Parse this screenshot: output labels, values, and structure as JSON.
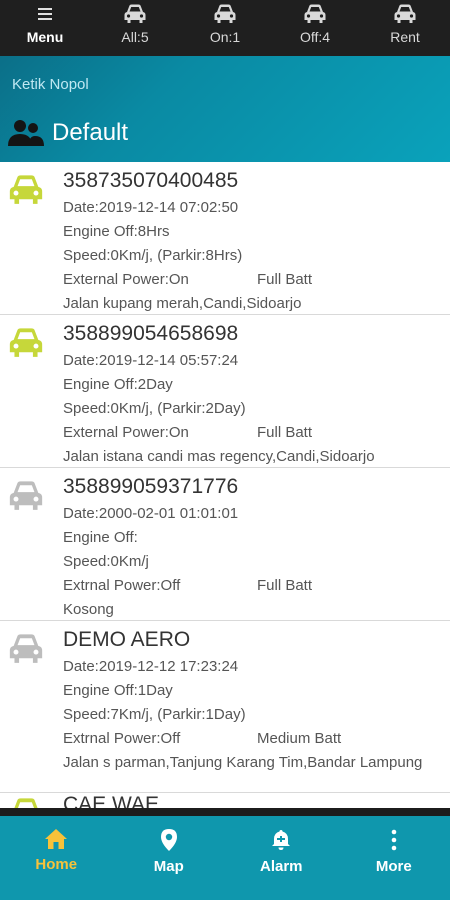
{
  "toolbar": {
    "menu_label": "Menu",
    "all_label": "All:5",
    "on_label": "On:1",
    "off_label": "Off:4",
    "rent_label": "Rent"
  },
  "header": {
    "search_placeholder": "Ketik Nopol",
    "group_title": "Default"
  },
  "colors": {
    "car_active": "#c6d73a",
    "car_inactive": "#bdbdbd",
    "accent": "#0f97ad",
    "active_nav": "#f7c23a"
  },
  "vehicles": [
    {
      "id": "358735070400485",
      "date": "Date:2019-12-14 07:02:50",
      "engine": "Engine Off:8Hrs",
      "speed": "Speed:0Km/j, (Parkir:8Hrs)",
      "power": "External Power:On",
      "batt": "Full Batt",
      "address": "Jalan kupang merah,Candi,Sidoarjo",
      "icon_color": "#c6d73a"
    },
    {
      "id": "358899054658698",
      "date": "Date:2019-12-14 05:57:24",
      "engine": "Engine Off:2Day",
      "speed": "Speed:0Km/j, (Parkir:2Day)",
      "power": "External Power:On",
      "batt": "Full Batt",
      "address": "Jalan istana candi mas regency,Candi,Sidoarjo",
      "icon_color": "#c6d73a"
    },
    {
      "id": "358899059371776",
      "date": "Date:2000-02-01 01:01:01",
      "engine": "Engine Off:",
      "speed": "Speed:0Km/j",
      "power": "Extrnal Power:Off",
      "batt": "Full Batt",
      "address": "Kosong",
      "icon_color": "#bdbdbd"
    },
    {
      "id": "DEMO AERO",
      "date": "Date:2019-12-12 17:23:24",
      "engine": "Engine Off:1Day",
      "speed": "Speed:7Km/j, (Parkir:1Day)",
      "power": "Extrnal Power:Off",
      "batt": "Medium Batt",
      "address": "Jalan s parman,Tanjung Karang Tim,Bandar Lampung",
      "icon_color": "#bdbdbd"
    }
  ],
  "partial_item": {
    "id": "CAE WAE",
    "icon_color": "#c6d73a"
  },
  "nav": {
    "home": "Home",
    "map": "Map",
    "alarm": "Alarm",
    "more": "More"
  }
}
